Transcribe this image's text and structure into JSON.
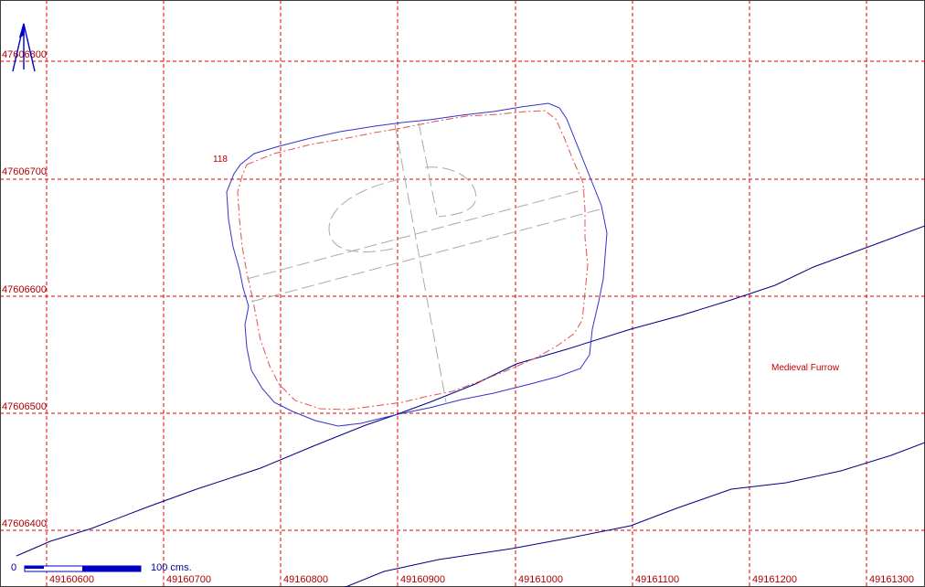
{
  "map": {
    "grid": {
      "easting_labels": [
        "49160600",
        "49160700",
        "49160800",
        "49160900",
        "49161000",
        "49161100",
        "49161200",
        "49161300"
      ],
      "northing_labels": [
        "47606800",
        "47606700",
        "47606600",
        "47606500",
        "47606400"
      ],
      "line_color": "#e00000"
    },
    "annotations": {
      "feature_number": "118",
      "furrow_label": "Medieval Furrow"
    },
    "scale_bar": {
      "start_label": "0",
      "end_label": "100 cms."
    },
    "north_arrow": {
      "icon": "north-arrow-icon"
    },
    "colors": {
      "outer_outline": "#3333cc",
      "inner_outline": "#e05050",
      "furrow_lines": "#000080",
      "section_lines": "#aaaaaa",
      "labels": "#b00000",
      "scale_bar": "#0000c0"
    }
  }
}
